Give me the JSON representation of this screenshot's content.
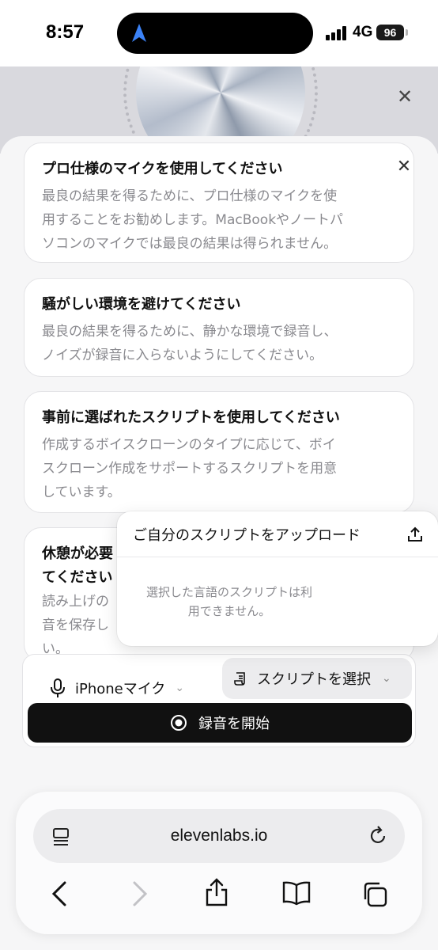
{
  "status_bar": {
    "time": "8:57",
    "network": "4G",
    "battery": "96"
  },
  "tips": [
    {
      "title": "プロ仕様のマイクを使用してください",
      "body": [
        "最良の結果を得るために、プロ仕様のマイクを使",
        "用することをお勧めします。MacBookやノートパ",
        "ソコンのマイクでは最良の結果は得られません。"
      ]
    },
    {
      "title": "騒がしい環境を避けてください",
      "body": [
        "最良の結果を得るために、静かな環境で録音し、",
        "ノイズが録音に入らないようにしてください。"
      ]
    },
    {
      "title": "事前に選ばれたスクリプトを使用してください",
      "body": [
        "作成するボイスクローンのタイプに応じて、ボイ",
        "スクローン作成をサポートするスクリプトを用意",
        "しています。"
      ]
    },
    {
      "title_lines": [
        "休憩が必要",
        "てください"
      ],
      "body": [
        "読み上げの",
        "音を保存し",
        "い。"
      ]
    }
  ],
  "controls": {
    "mic_label": "iPhoneマイク",
    "script_label": "スクリプトを選択",
    "record_label": "録音を開始"
  },
  "popover": {
    "upload_label": "ご自分のスクリプトをアップロード",
    "note_lines": [
      "選択した言語のスクリプトは利",
      "用できません。"
    ]
  },
  "browser": {
    "url": "elevenlabs.io"
  },
  "icons": {
    "location": "location-arrow-icon",
    "close": "close-icon",
    "mic": "microphone-icon",
    "script": "script-icon",
    "record": "record-icon",
    "upload": "upload-icon",
    "page": "page-menu-icon",
    "reload": "reload-icon",
    "back": "back-icon",
    "forward": "forward-icon",
    "share": "share-icon",
    "bookmarks": "bookmarks-icon",
    "tabs": "tabs-icon"
  },
  "colors": {
    "accent_blue": "#3b82f6",
    "record_bg": "#111111"
  }
}
